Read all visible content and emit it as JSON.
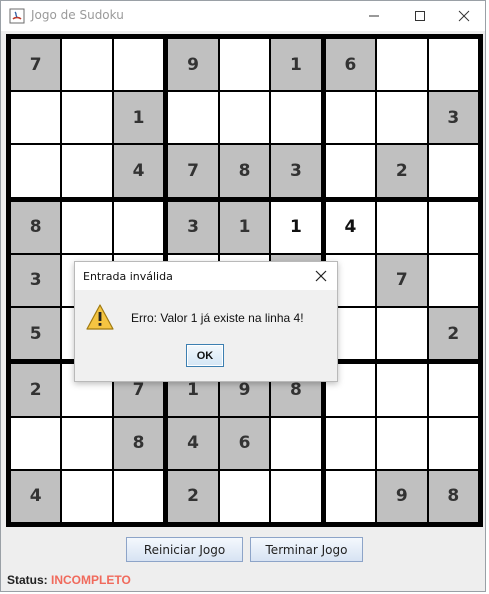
{
  "window": {
    "title": "Jogo de Sudoku",
    "controls": [
      "minimize",
      "maximize",
      "close"
    ]
  },
  "board": {
    "rows": [
      [
        "7",
        "",
        "",
        "9",
        "",
        "1",
        "6",
        "",
        ""
      ],
      [
        "",
        "",
        "1",
        "",
        "",
        "",
        "",
        "",
        "3"
      ],
      [
        "",
        "",
        "4",
        "7",
        "8",
        "3",
        "",
        "2",
        ""
      ],
      [
        "8",
        "",
        "",
        "3",
        "1",
        "1",
        "4",
        "",
        ""
      ],
      [
        "3",
        "",
        "",
        "",
        "",
        "",
        "",
        "7",
        ""
      ],
      [
        "5",
        "",
        "",
        "",
        "",
        "",
        "",
        "",
        "2"
      ],
      [
        "2",
        "",
        "7",
        "1",
        "9",
        "8",
        "",
        "",
        ""
      ],
      [
        "",
        "",
        "8",
        "4",
        "6",
        "",
        "",
        "",
        ""
      ],
      [
        "4",
        "",
        "",
        "2",
        "",
        "",
        "",
        "9",
        "8"
      ]
    ],
    "given": [
      [
        1,
        0,
        0,
        1,
        0,
        1,
        1,
        0,
        0
      ],
      [
        0,
        0,
        1,
        0,
        0,
        0,
        0,
        0,
        1
      ],
      [
        0,
        0,
        1,
        1,
        1,
        1,
        0,
        1,
        0
      ],
      [
        1,
        0,
        0,
        1,
        1,
        0,
        0,
        0,
        0
      ],
      [
        1,
        0,
        0,
        0,
        0,
        1,
        0,
        1,
        0
      ],
      [
        1,
        0,
        0,
        0,
        0,
        0,
        0,
        0,
        1
      ],
      [
        1,
        0,
        1,
        1,
        1,
        1,
        0,
        0,
        0
      ],
      [
        0,
        0,
        1,
        1,
        1,
        0,
        0,
        0,
        0
      ],
      [
        1,
        0,
        0,
        1,
        0,
        0,
        0,
        1,
        1
      ]
    ]
  },
  "buttons": {
    "restart": "Reiniciar Jogo",
    "finish": "Terminar Jogo"
  },
  "status": {
    "label": "Status:",
    "value": "INCOMPLETO"
  },
  "dialog": {
    "title": "Entrada inválida",
    "message": "Erro: Valor 1 já existe na linha 4!",
    "ok": "OK",
    "icon": "warning-icon"
  },
  "colors": {
    "given_cell": "#c0c0c0",
    "empty_cell": "#ffffff",
    "grid_line": "#000000",
    "status_value": "#f06a5c",
    "window_bg": "#eeeeee"
  }
}
